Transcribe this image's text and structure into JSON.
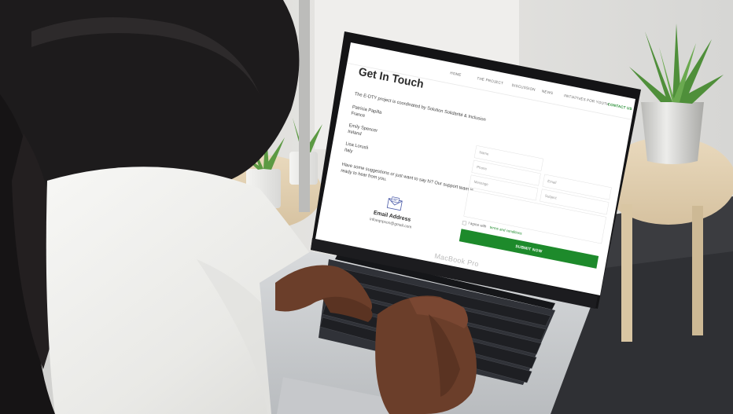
{
  "website": {
    "nav": [
      {
        "label": "HOME",
        "active": false
      },
      {
        "label": "THE PROJECT",
        "active": false
      },
      {
        "label": "DISCUSSION",
        "active": false
      },
      {
        "label": "NEWS",
        "active": false
      },
      {
        "label": "INITIATIVES FOR YOUTH",
        "active": false
      },
      {
        "label": "CONTACT US",
        "active": true
      }
    ],
    "page_title": "Get In Touch",
    "intro": "The E-DTY project is coordinated by Solution Solidarité & Inclusion",
    "contacts": [
      {
        "name": "Patricia Papilla",
        "country": "France"
      },
      {
        "name": "Emily Spencer",
        "country": "Ireland"
      },
      {
        "name": "Lisa Lorusli",
        "country": "Italy"
      }
    ],
    "suggestion_line1": "Have some suggestions or just want to say hi? Our support team is",
    "suggestion_line2": "ready to hear from you.",
    "email_heading": "Email Address",
    "email_value": "infoeqnpxon@gmail.com",
    "form": {
      "name_placeholder": "Name",
      "phone_placeholder": "Phone",
      "email_placeholder": "Email",
      "message_placeholder": "Message",
      "subject_placeholder": "Subject",
      "agree_text": "I agree with",
      "terms_link": "terms and conditions",
      "submit_label": "SUBMIT NOW"
    }
  },
  "laptop_brand": "MacBook Pro",
  "colors": {
    "accent_green": "#1d8a2b",
    "laptop_silver": "#c9cbce",
    "keyboard_dark": "#2a2c31"
  }
}
